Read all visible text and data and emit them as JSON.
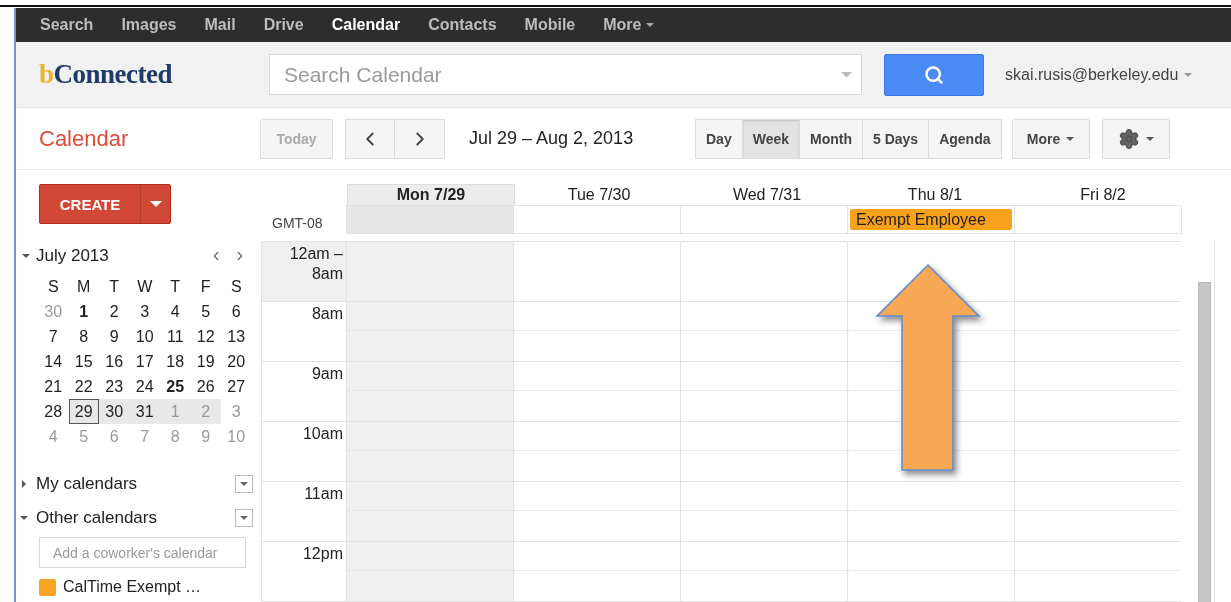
{
  "nav": [
    {
      "label": "Search",
      "kind": "link",
      "selected": false
    },
    {
      "label": "Images",
      "kind": "link",
      "selected": false
    },
    {
      "label": "Mail",
      "kind": "link",
      "selected": false
    },
    {
      "label": "Drive",
      "kind": "link",
      "selected": false
    },
    {
      "label": "Calendar",
      "kind": "link",
      "selected": true
    },
    {
      "label": "Contacts",
      "kind": "link",
      "selected": false
    },
    {
      "label": "Mobile",
      "kind": "link",
      "selected": false
    },
    {
      "label": "More",
      "kind": "menu",
      "selected": false
    }
  ],
  "header": {
    "logo": {
      "initial": "b",
      "rest": "Connected"
    },
    "search": {
      "placeholder": "Search Calendar"
    },
    "account": "skai.rusis@berkeley.edu"
  },
  "toolbar": {
    "title": "Calendar",
    "today": "Today",
    "date_range": "Jul 29 – Aug 2, 2013",
    "views": [
      {
        "label": "Day",
        "selected": false
      },
      {
        "label": "Week",
        "selected": true
      },
      {
        "label": "Month",
        "selected": false
      },
      {
        "label": "5 Days",
        "selected": false
      },
      {
        "label": "Agenda",
        "selected": false
      }
    ],
    "more": "More"
  },
  "sidebar": {
    "create": "CREATE",
    "mini_calendar": {
      "month": "July 2013",
      "weekdays": [
        "S",
        "M",
        "T",
        "W",
        "T",
        "F",
        "S"
      ],
      "weeks": [
        [
          {
            "d": "30",
            "muted": true,
            "bold": false,
            "in_range": false,
            "selected": false
          },
          {
            "d": "1",
            "muted": false,
            "bold": true,
            "in_range": false,
            "selected": false
          },
          {
            "d": "2",
            "muted": false,
            "bold": false,
            "in_range": false,
            "selected": false
          },
          {
            "d": "3",
            "muted": false,
            "bold": false,
            "in_range": false,
            "selected": false
          },
          {
            "d": "4",
            "muted": false,
            "bold": false,
            "in_range": false,
            "selected": false
          },
          {
            "d": "5",
            "muted": false,
            "bold": false,
            "in_range": false,
            "selected": false
          },
          {
            "d": "6",
            "muted": false,
            "bold": false,
            "in_range": false,
            "selected": false
          }
        ],
        [
          {
            "d": "7",
            "muted": false,
            "bold": false,
            "in_range": false,
            "selected": false
          },
          {
            "d": "8",
            "muted": false,
            "bold": false,
            "in_range": false,
            "selected": false
          },
          {
            "d": "9",
            "muted": false,
            "bold": false,
            "in_range": false,
            "selected": false
          },
          {
            "d": "10",
            "muted": false,
            "bold": false,
            "in_range": false,
            "selected": false
          },
          {
            "d": "11",
            "muted": false,
            "bold": false,
            "in_range": false,
            "selected": false
          },
          {
            "d": "12",
            "muted": false,
            "bold": false,
            "in_range": false,
            "selected": false
          },
          {
            "d": "13",
            "muted": false,
            "bold": false,
            "in_range": false,
            "selected": false
          }
        ],
        [
          {
            "d": "14",
            "muted": false,
            "bold": false,
            "in_range": false,
            "selected": false
          },
          {
            "d": "15",
            "muted": false,
            "bold": false,
            "in_range": false,
            "selected": false
          },
          {
            "d": "16",
            "muted": false,
            "bold": false,
            "in_range": false,
            "selected": false
          },
          {
            "d": "17",
            "muted": false,
            "bold": false,
            "in_range": false,
            "selected": false
          },
          {
            "d": "18",
            "muted": false,
            "bold": false,
            "in_range": false,
            "selected": false
          },
          {
            "d": "19",
            "muted": false,
            "bold": false,
            "in_range": false,
            "selected": false
          },
          {
            "d": "20",
            "muted": false,
            "bold": false,
            "in_range": false,
            "selected": false
          }
        ],
        [
          {
            "d": "21",
            "muted": false,
            "bold": false,
            "in_range": false,
            "selected": false
          },
          {
            "d": "22",
            "muted": false,
            "bold": false,
            "in_range": false,
            "selected": false
          },
          {
            "d": "23",
            "muted": false,
            "bold": false,
            "in_range": false,
            "selected": false
          },
          {
            "d": "24",
            "muted": false,
            "bold": false,
            "in_range": false,
            "selected": false
          },
          {
            "d": "25",
            "muted": false,
            "bold": true,
            "in_range": false,
            "selected": false
          },
          {
            "d": "26",
            "muted": false,
            "bold": false,
            "in_range": false,
            "selected": false
          },
          {
            "d": "27",
            "muted": false,
            "bold": false,
            "in_range": false,
            "selected": false
          }
        ],
        [
          {
            "d": "28",
            "muted": false,
            "bold": false,
            "in_range": false,
            "selected": false
          },
          {
            "d": "29",
            "muted": false,
            "bold": false,
            "in_range": true,
            "selected": true
          },
          {
            "d": "30",
            "muted": false,
            "bold": false,
            "in_range": true,
            "selected": false
          },
          {
            "d": "31",
            "muted": false,
            "bold": false,
            "in_range": true,
            "selected": false
          },
          {
            "d": "1",
            "muted": true,
            "bold": false,
            "in_range": true,
            "selected": false
          },
          {
            "d": "2",
            "muted": true,
            "bold": false,
            "in_range": true,
            "selected": false
          },
          {
            "d": "3",
            "muted": true,
            "bold": false,
            "in_range": false,
            "selected": false
          }
        ],
        [
          {
            "d": "4",
            "muted": true,
            "bold": false,
            "in_range": false,
            "selected": false
          },
          {
            "d": "5",
            "muted": true,
            "bold": false,
            "in_range": false,
            "selected": false
          },
          {
            "d": "6",
            "muted": true,
            "bold": false,
            "in_range": false,
            "selected": false
          },
          {
            "d": "7",
            "muted": true,
            "bold": false,
            "in_range": false,
            "selected": false
          },
          {
            "d": "8",
            "muted": true,
            "bold": false,
            "in_range": false,
            "selected": false
          },
          {
            "d": "9",
            "muted": true,
            "bold": false,
            "in_range": false,
            "selected": false
          },
          {
            "d": "10",
            "muted": true,
            "bold": false,
            "in_range": false,
            "selected": false
          }
        ]
      ]
    },
    "sections": [
      {
        "title": "My calendars",
        "expanded": false
      },
      {
        "title": "Other calendars",
        "expanded": true
      }
    ],
    "add_field": {
      "placeholder": "Add a coworker's calendar"
    },
    "calendars": [
      {
        "name": "CalTime Exempt …",
        "color": "#f6a623"
      }
    ]
  },
  "week": {
    "timezone": "GMT-08",
    "days": [
      {
        "label": "Mon 7/29",
        "selected": true
      },
      {
        "label": "Tue 7/30",
        "selected": false
      },
      {
        "label": "Wed 7/31",
        "selected": false
      },
      {
        "label": "Thu 8/1",
        "selected": false,
        "all_day": [
          {
            "title": "Exempt Employee",
            "color": "#f9a11b"
          }
        ]
      },
      {
        "label": "Fri 8/2",
        "selected": false
      }
    ],
    "times": [
      "12am – 8am",
      "8am",
      "9am",
      "10am",
      "11am",
      "12pm"
    ]
  }
}
